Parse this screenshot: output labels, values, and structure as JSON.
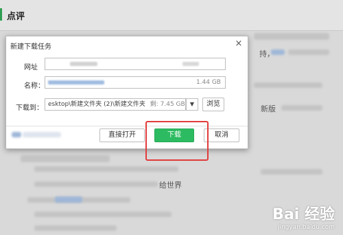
{
  "background": {
    "section_title": "点评",
    "snippet_right": "持，",
    "snippet_new": "新版",
    "snippet_world": "给世界"
  },
  "dialog": {
    "title": "新建下载任务",
    "close_label": "×",
    "url_label": "网址",
    "name_label": "名称：",
    "file_size": "1.44 GB",
    "save_to_label": "下载到：",
    "save_path": "esktop\\新建文件夹 (2)\\新建文件夹",
    "free_space": "剩: 7.45 GB",
    "browse_label": "浏览",
    "open_direct_label": "直接打开",
    "download_label": "下载",
    "cancel_label": "取消"
  },
  "watermark": {
    "brand": "Bai 经验",
    "url": "jingyan.baidu.com"
  },
  "colors": {
    "primary_green": "#2dbb61",
    "highlight_red": "#e23b3b"
  }
}
